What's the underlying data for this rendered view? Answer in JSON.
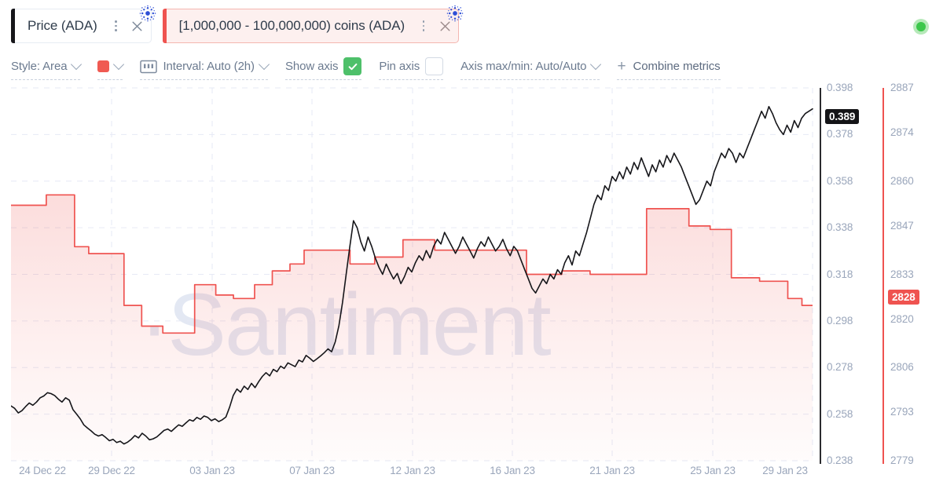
{
  "metrics": [
    {
      "label": "Price (ADA)",
      "color": "#16161a",
      "asset_icon": "cardano-logo-icon",
      "menu_icon": "kebab-menu-icon",
      "close_icon": "close-icon"
    },
    {
      "label": "[1,000,000 - 100,000,000) coins (ADA)",
      "color": "#ef5350",
      "asset_icon": "cardano-logo-icon",
      "menu_icon": "kebab-menu-icon",
      "close_icon": "close-icon"
    }
  ],
  "status": {
    "name": "live-status-dot",
    "color": "#3cc74b"
  },
  "toolbar": {
    "style": {
      "label": "Style: Area",
      "caret": "chevron-down-icon"
    },
    "color": {
      "swatch": "#f05a52",
      "caret": "chevron-down-icon"
    },
    "interval": {
      "label": "Interval: Auto (2h)",
      "icon": "interval-bars-icon",
      "caret": "chevron-down-icon"
    },
    "show_axis": {
      "label": "Show axis",
      "checked": true,
      "check_icon": "checkmark-icon"
    },
    "pin_axis": {
      "label": "Pin axis",
      "checked": false
    },
    "axis_minmax": {
      "label": "Axis max/min: Auto/Auto",
      "caret": "chevron-down-icon"
    },
    "combine": {
      "label": "Combine metrics",
      "icon": "plus-icon"
    }
  },
  "watermark": "·Santiment",
  "chart_data": {
    "type": "line",
    "title": "",
    "xlabel": "",
    "grid": true,
    "legend_position": "top",
    "x_ticks": [
      "24 Dec 22",
      "29 Dec 22",
      "03 Jan 23",
      "07 Jan 23",
      "12 Jan 23",
      "16 Jan 23",
      "21 Jan 23",
      "25 Jan 23",
      "29 Jan 23"
    ],
    "axes": [
      {
        "id": "price",
        "name": "Price (ADA)",
        "side": "right",
        "color": "#2b2b2f",
        "ticks": [
          0.398,
          0.378,
          0.358,
          0.338,
          0.318,
          0.298,
          0.278,
          0.258,
          0.238
        ],
        "ylim": [
          0.238,
          0.398
        ],
        "current_value": "0.389"
      },
      {
        "id": "coins",
        "name": "[1,000,000 - 100,000,000) coins (ADA)",
        "side": "right",
        "color": "#ef5350",
        "ticks": [
          2887,
          2874,
          2860,
          2847,
          2833,
          2820,
          2806,
          2793,
          2779
        ],
        "ylim": [
          2779,
          2887
        ],
        "current_value": "2828"
      }
    ],
    "series": [
      {
        "name": "Price (ADA)",
        "axis": "price",
        "color": "#16161a",
        "style": "line",
        "values": [
          0.2615,
          0.2605,
          0.2585,
          0.2595,
          0.2612,
          0.2628,
          0.2618,
          0.2632,
          0.265,
          0.2658,
          0.2672,
          0.2668,
          0.266,
          0.2644,
          0.2632,
          0.265,
          0.264,
          0.26,
          0.258,
          0.256,
          0.2534,
          0.252,
          0.2508,
          0.2494,
          0.2486,
          0.2492,
          0.248,
          0.2466,
          0.2472,
          0.2458,
          0.2464,
          0.2452,
          0.246,
          0.2472,
          0.2488,
          0.2478,
          0.2498,
          0.2486,
          0.247,
          0.2474,
          0.2482,
          0.2496,
          0.251,
          0.2516,
          0.2506,
          0.252,
          0.2534,
          0.2528,
          0.2542,
          0.2556,
          0.255,
          0.2566,
          0.2558,
          0.2572,
          0.2566,
          0.2552,
          0.256,
          0.2548,
          0.2556,
          0.2568,
          0.261,
          0.266,
          0.2688,
          0.2674,
          0.27,
          0.2686,
          0.2712,
          0.2694,
          0.272,
          0.2742,
          0.2758,
          0.2744,
          0.2772,
          0.2762,
          0.2786,
          0.2776,
          0.28,
          0.2792,
          0.2784,
          0.2812,
          0.2804,
          0.2832,
          0.282,
          0.2806,
          0.2818,
          0.283,
          0.2844,
          0.286,
          0.2848,
          0.289,
          0.296,
          0.306,
          0.318,
          0.33,
          0.341,
          0.338,
          0.332,
          0.328,
          0.334,
          0.33,
          0.325,
          0.321,
          0.318,
          0.3224,
          0.319,
          0.316,
          0.3184,
          0.314,
          0.317,
          0.321,
          0.319,
          0.323,
          0.326,
          0.324,
          0.3282,
          0.325,
          0.33,
          0.333,
          0.331,
          0.336,
          0.333,
          0.33,
          0.327,
          0.33,
          0.334,
          0.331,
          0.328,
          0.325,
          0.329,
          0.332,
          0.33,
          0.334,
          0.331,
          0.328,
          0.33,
          0.333,
          0.329,
          0.326,
          0.33,
          0.328,
          0.324,
          0.32,
          0.316,
          0.312,
          0.31,
          0.313,
          0.316,
          0.314,
          0.318,
          0.316,
          0.32,
          0.318,
          0.323,
          0.326,
          0.322,
          0.328,
          0.326,
          0.331,
          0.336,
          0.342,
          0.348,
          0.352,
          0.35,
          0.356,
          0.354,
          0.36,
          0.358,
          0.362,
          0.359,
          0.364,
          0.361,
          0.366,
          0.363,
          0.368,
          0.364,
          0.36,
          0.365,
          0.362,
          0.367,
          0.364,
          0.369,
          0.366,
          0.37,
          0.367,
          0.364,
          0.36,
          0.356,
          0.352,
          0.348,
          0.35,
          0.354,
          0.358,
          0.356,
          0.362,
          0.366,
          0.37,
          0.368,
          0.372,
          0.37,
          0.366,
          0.37,
          0.368,
          0.372,
          0.376,
          0.38,
          0.384,
          0.388,
          0.385,
          0.39,
          0.387,
          0.383,
          0.38,
          0.378,
          0.382,
          0.379,
          0.384,
          0.381,
          0.385,
          0.387,
          0.388,
          0.389
        ]
      },
      {
        "name": "[1,000,000 - 100,000,000) coins (ADA)",
        "axis": "coins",
        "color": "#ef5350",
        "style": "area",
        "step": true,
        "values": [
          2853,
          2853,
          2853,
          2853,
          2853,
          2853,
          2853,
          2853,
          2853,
          2853,
          2856,
          2856,
          2856,
          2856,
          2856,
          2856,
          2856,
          2856,
          2841,
          2841,
          2841,
          2841,
          2839,
          2839,
          2839,
          2839,
          2839,
          2839,
          2839,
          2839,
          2839,
          2839,
          2824,
          2824,
          2824,
          2824,
          2824,
          2818,
          2818,
          2818,
          2818,
          2818,
          2818,
          2816,
          2816,
          2816,
          2816,
          2816,
          2816,
          2816,
          2816,
          2816,
          2830,
          2830,
          2830,
          2830,
          2830,
          2830,
          2827,
          2827,
          2827,
          2827,
          2827,
          2826,
          2826,
          2826,
          2826,
          2826,
          2826,
          2830,
          2830,
          2830,
          2830,
          2830,
          2834,
          2834,
          2834,
          2834,
          2834,
          2836,
          2836,
          2836,
          2836,
          2840,
          2840,
          2840,
          2840,
          2840,
          2840,
          2840,
          2840,
          2840,
          2840,
          2840,
          2840,
          2840,
          2836,
          2836,
          2836,
          2836,
          2836,
          2836,
          2836,
          2838,
          2838,
          2838,
          2838,
          2838,
          2838,
          2838,
          2838,
          2843,
          2843,
          2843,
          2843,
          2843,
          2843,
          2843,
          2843,
          2843,
          2840,
          2840,
          2840,
          2840,
          2840,
          2840,
          2840,
          2840,
          2840,
          2840,
          2840,
          2840,
          2840,
          2840,
          2840,
          2840,
          2840,
          2840,
          2840,
          2840,
          2840,
          2840,
          2840,
          2840,
          2840,
          2840,
          2833,
          2833,
          2833,
          2833,
          2833,
          2833,
          2833,
          2833,
          2833,
          2833,
          2834,
          2834,
          2834,
          2834,
          2834,
          2834,
          2834,
          2834,
          2833,
          2833,
          2833,
          2833,
          2833,
          2833,
          2833,
          2833,
          2833,
          2833,
          2833,
          2833,
          2833,
          2833,
          2833,
          2833,
          2852,
          2852,
          2852,
          2852,
          2852,
          2852,
          2852,
          2852,
          2852,
          2852,
          2852,
          2852,
          2847,
          2847,
          2847,
          2847,
          2847,
          2847,
          2846,
          2846,
          2846,
          2846,
          2846,
          2846,
          2832,
          2832,
          2832,
          2832,
          2832,
          2832,
          2832,
          2832,
          2831,
          2831,
          2831,
          2831,
          2831,
          2831,
          2831,
          2831,
          2826,
          2826,
          2826,
          2826,
          2824,
          2824,
          2824
        ]
      }
    ]
  }
}
